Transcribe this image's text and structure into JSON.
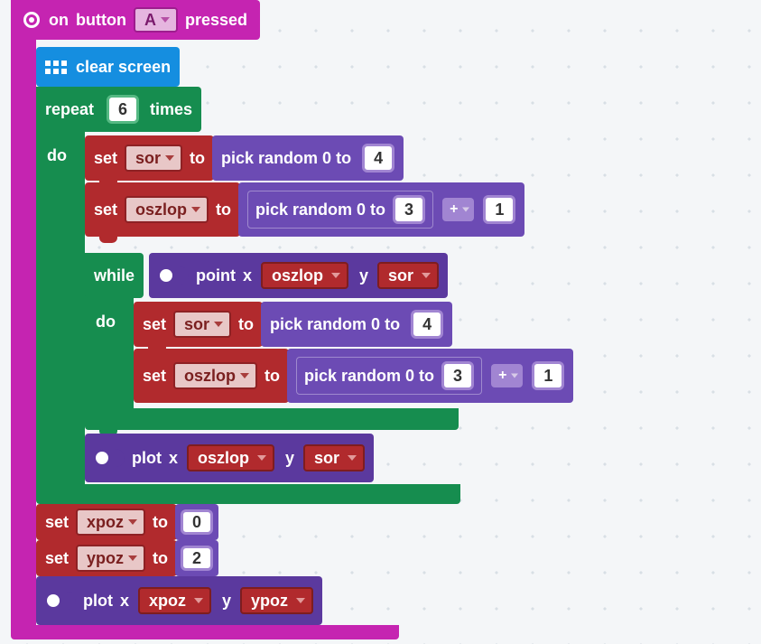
{
  "header": {
    "on": "on",
    "button": "button",
    "btn_val": "A",
    "pressed": "pressed"
  },
  "clear": "clear screen",
  "repeat": "repeat",
  "times": "times",
  "repeat_n": "6",
  "do": "do",
  "set": "set",
  "to": "to",
  "vars": {
    "sor": "sor",
    "oszlop": "oszlop",
    "xpoz": "xpoz",
    "ypoz": "ypoz"
  },
  "pick": "pick random 0 to",
  "pick_max_4": "4",
  "pick_max_3": "3",
  "plus": "+",
  "one": "1",
  "while": "while",
  "point": "point",
  "plot": "plot",
  "x": "x",
  "y": "y",
  "xpoz_v": "0",
  "ypoz_v": "2"
}
